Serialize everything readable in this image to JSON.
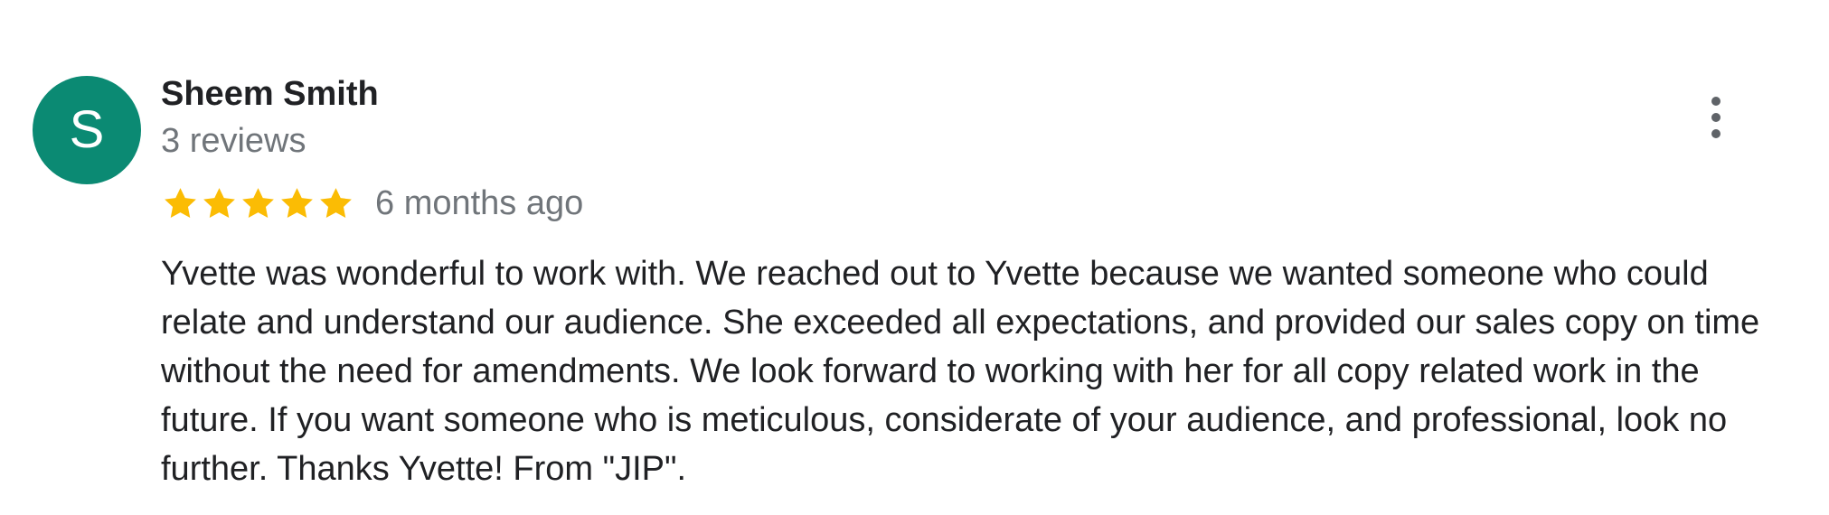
{
  "review": {
    "avatar_initial": "S",
    "reviewer_name": "Sheem Smith",
    "review_count": "3 reviews",
    "rating_stars": 5,
    "rating_max": 5,
    "time_ago": "6 months ago",
    "text": "Yvette was wonderful to work with. We reached out to Yvette because we wanted someone who could relate and understand our audience. She exceeded all expectations, and provided our sales copy on time without the need for amendments. We look forward to working with her for all copy related work in the future. If you want someone who is meticulous, considerate of your audience, and professional, look no further. Thanks Yvette! From \"JIP\"."
  },
  "icons": {
    "star": "star-icon",
    "more": "more-vertical-icon"
  },
  "colors": {
    "avatar_background": "#0b8a73",
    "star": "#fbbc04",
    "name_text": "#202124",
    "secondary_text": "#70757a",
    "body_text": "#202124",
    "more_icon": "#5f6368"
  }
}
